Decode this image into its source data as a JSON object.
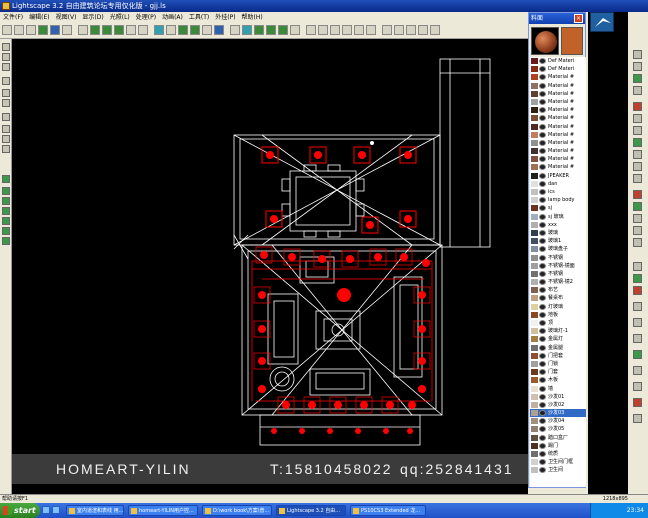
{
  "window": {
    "title": "Lightscape 3.2 自由建筑论坛专用仅化版 - gjj.ls"
  },
  "menu": [
    "文件(F)",
    "编辑(E)",
    "视图(V)",
    "显示(D)",
    "光照(L)",
    "处理(P)",
    "动画(A)",
    "工具(T)",
    "外挂(P)",
    "帮助(H)"
  ],
  "materials_panel": {
    "title": "料面",
    "items": [
      {
        "label": "Def Materi",
        "swatch": "#6a1a1a"
      },
      {
        "label": "Def Materi",
        "swatch": "#8a2a10"
      },
      {
        "label": "Material #",
        "swatch": "#b04020"
      },
      {
        "label": "Material #",
        "swatch": "#907060"
      },
      {
        "label": "Material #",
        "swatch": "#604030"
      },
      {
        "label": "Material #",
        "swatch": "#a0a0a0"
      },
      {
        "label": "Material #",
        "swatch": "#302010"
      },
      {
        "label": "Material #",
        "swatch": "#7a5030"
      },
      {
        "label": "Material #",
        "swatch": "#502a20"
      },
      {
        "label": "Material #",
        "swatch": "#c08060"
      },
      {
        "label": "Material #",
        "swatch": "#909090"
      },
      {
        "label": "Material #",
        "swatch": "#403030"
      },
      {
        "label": "Material #",
        "swatch": "#805040"
      },
      {
        "label": "Material #",
        "swatch": "#a07050"
      },
      {
        "label": "JPEAKER",
        "swatch": "#202020"
      },
      {
        "label": "dan",
        "swatch": "#e0e0e0"
      },
      {
        "label": "ics",
        "swatch": "#c0c0c0"
      },
      {
        "label": "lamp body",
        "swatch": "#d0d0d0"
      },
      {
        "label": "sj",
        "swatch": "#703020"
      },
      {
        "label": "sj 玻璃",
        "swatch": "#a0b0c0"
      },
      {
        "label": "xxx",
        "swatch": "#b0b0b0"
      },
      {
        "label": "玻璃",
        "swatch": "#304050"
      },
      {
        "label": "玻璃1",
        "swatch": "#405060"
      },
      {
        "label": "玻璃盘子",
        "swatch": "#8090a0"
      },
      {
        "label": "不锈钢",
        "swatch": "#909090"
      },
      {
        "label": "不锈钢-镜面",
        "swatch": "#a0a0a0"
      },
      {
        "label": "不锈钢",
        "swatch": "#707070"
      },
      {
        "label": "不锈钢-镜2",
        "swatch": "#b0b0b0"
      },
      {
        "label": "布艺",
        "swatch": "#806050"
      },
      {
        "label": "餐桌布",
        "swatch": "#c0a080"
      },
      {
        "label": "灯玻璃",
        "swatch": "#e0d0a0"
      },
      {
        "label": "地板",
        "swatch": "#8a4a20"
      },
      {
        "label": "顶",
        "swatch": "#f0f0f0"
      },
      {
        "label": "玻璃灯-1",
        "swatch": "#d0c0a0"
      },
      {
        "label": "金属灯",
        "swatch": "#a08040"
      },
      {
        "label": "金属腿",
        "swatch": "#707070"
      },
      {
        "label": "门把套",
        "swatch": "#905030"
      },
      {
        "label": "门锁",
        "swatch": "#a0a0a0"
      },
      {
        "label": "门套",
        "swatch": "#6a3a1a"
      },
      {
        "label": "木板",
        "swatch": "#9a5a2a"
      },
      {
        "label": "墙",
        "swatch": "#e8e0d0"
      },
      {
        "label": "沙发01",
        "swatch": "#d0c0b0"
      },
      {
        "label": "沙发02",
        "swatch": "#c0b0a0"
      },
      {
        "label": "沙发03",
        "swatch": "#b0a090"
      },
      {
        "label": "沙发04",
        "swatch": "#a09080"
      },
      {
        "label": "沙发05",
        "swatch": "#908070"
      },
      {
        "label": "踏口盒厂",
        "swatch": "#605040"
      },
      {
        "label": "踢门",
        "swatch": "#503020"
      },
      {
        "label": "统质",
        "swatch": "#707070"
      },
      {
        "label": "卫生间门框",
        "swatch": "#d0d0d0"
      },
      {
        "label": "卫生间",
        "swatch": "#c0c0c0"
      }
    ],
    "selected_index": 43
  },
  "watermark": {
    "brand": "HOMEART-YILIN",
    "tel": "T:15810458022",
    "qq": "qq:252841431"
  },
  "status": {
    "text": "帮助请按F1",
    "coords": "1218x895"
  },
  "taskbar": {
    "start_label": "start",
    "tasks": [
      "室内道渲和表线 用...",
      "homeart-YILIN用户控...",
      "D:\\work book\\方案\\普...",
      "Lightscape 3.2 自由...",
      "PS10CS3 Extended 龙..."
    ],
    "clock": "23:34"
  },
  "colors": {
    "accent": "#ff0000",
    "wire": "#ffffff"
  }
}
